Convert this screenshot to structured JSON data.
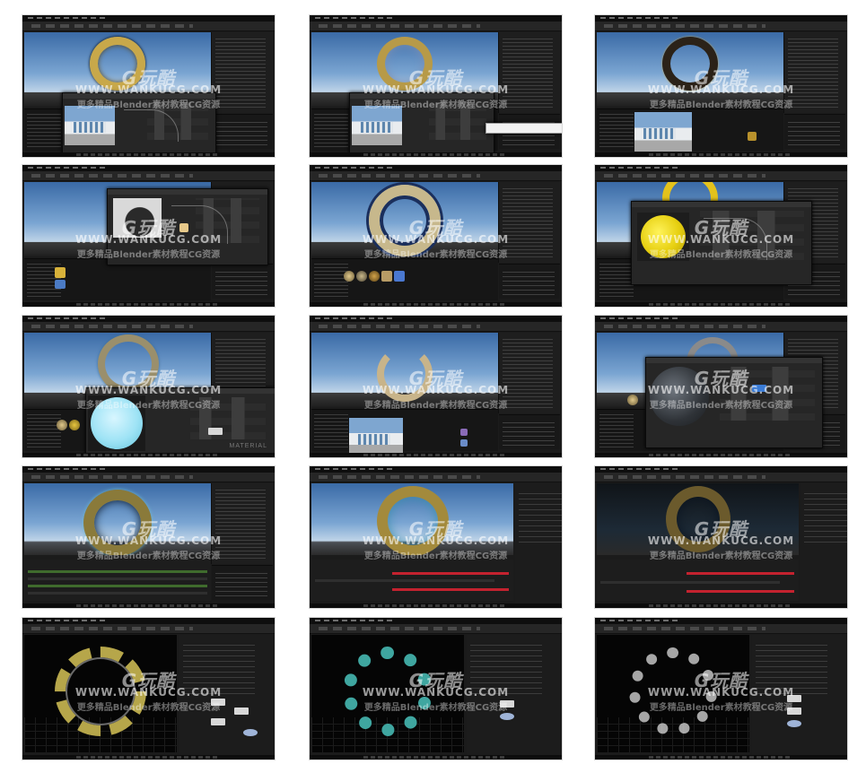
{
  "page": {
    "background": "#ffffff",
    "thumbnail_count": 15,
    "columns": 3,
    "rows": 5
  },
  "watermark": {
    "logo_text": "G玩酷",
    "url_text": "WWW.WANKUCG.COM",
    "sub_text": "更多精品Blender素材教程CG资源"
  },
  "thumbnails": [
    {
      "id": "ue-ring-material-editor-photo",
      "scene": "ring-sky",
      "ring_color": "#c8a84a"
    },
    {
      "id": "ue-ring-material-editor-tooltip",
      "scene": "ring-sky",
      "ring_color": "#b79a48"
    },
    {
      "id": "ue-ring-dark-asset",
      "scene": "ring-sky",
      "ring_color": "#2b2218"
    },
    {
      "id": "ue-ring-hidden-node-graph",
      "scene": "ring-sky",
      "ring_color": "#666666"
    },
    {
      "id": "ue-ring-textured-blue",
      "scene": "ring-sky",
      "ring_color": "#c7b88c"
    },
    {
      "id": "ue-ring-yellow-preview",
      "scene": "ring-sky",
      "ring_color": "#e3c21c"
    },
    {
      "id": "ue-ring-cyan-preview",
      "scene": "ring-sky",
      "ring_color": "#9a8f6c",
      "label": "MATERIAL"
    },
    {
      "id": "ue-ring-broken-arc",
      "scene": "ring-sky",
      "ring_color": "#c8b48a"
    },
    {
      "id": "ue-ring-rock-preview",
      "scene": "ring-sky",
      "ring_color": "#8a8a8a"
    },
    {
      "id": "ue-ring-niagara-timeline-green",
      "scene": "ring-timeline",
      "ring_color": "#8a7a3a"
    },
    {
      "id": "ue-ring-niagara-timeline-red",
      "scene": "ring-timeline",
      "ring_color": "#a38a3c"
    },
    {
      "id": "ue-ring-niagara-dark",
      "scene": "ring-timeline",
      "ring_color": "#6b5a2c"
    },
    {
      "id": "houdini-ring-yellow-wire",
      "scene": "ring-black",
      "ring_color": "#b6a64a"
    },
    {
      "id": "houdini-ring-cyan-points",
      "scene": "ring-black",
      "ring_color": "#3fa6a0"
    },
    {
      "id": "houdini-ring-white-points",
      "scene": "ring-black",
      "ring_color": "#cfcfcf"
    }
  ]
}
